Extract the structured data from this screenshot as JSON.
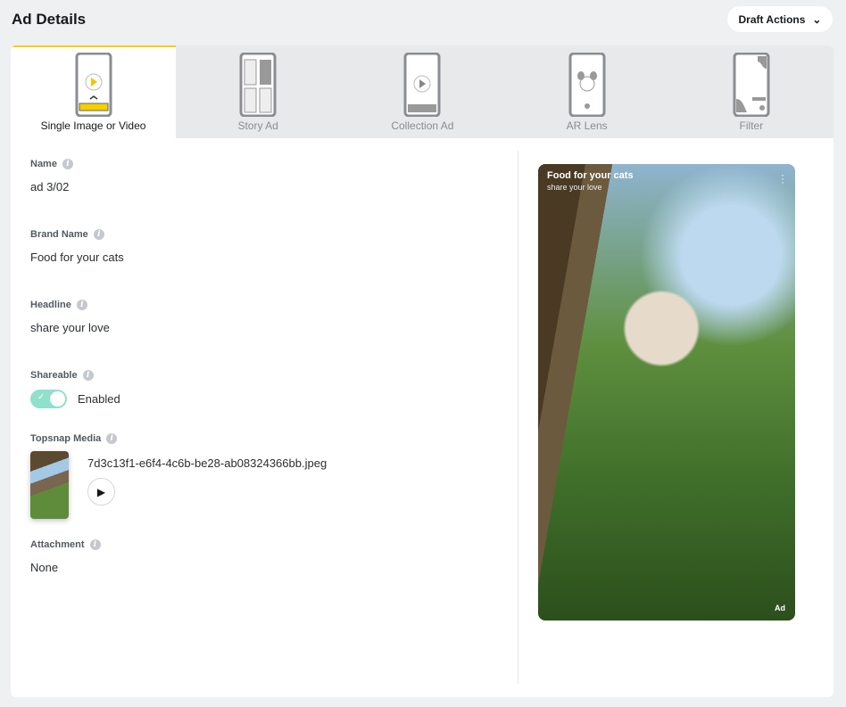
{
  "header": {
    "title": "Ad Details",
    "draft_actions": "Draft Actions"
  },
  "tabs": [
    {
      "label": "Single Image or Video",
      "active": true
    },
    {
      "label": "Story Ad"
    },
    {
      "label": "Collection Ad"
    },
    {
      "label": "AR Lens"
    },
    {
      "label": "Filter"
    }
  ],
  "fields": {
    "name": {
      "label": "Name",
      "value": "ad 3/02"
    },
    "brand": {
      "label": "Brand Name",
      "value": "Food for your cats"
    },
    "headline": {
      "label": "Headline",
      "value": "share your love"
    },
    "shareable": {
      "label": "Shareable",
      "value": "Enabled",
      "enabled": true
    },
    "media": {
      "label": "Topsnap Media",
      "filename": "7d3c13f1-e6f4-4c6b-be28-ab08324366bb.jpeg"
    },
    "attachment": {
      "label": "Attachment",
      "value": "None"
    }
  },
  "preview": {
    "brand": "Food for your cats",
    "headline": "share your love",
    "ad_badge": "Ad"
  },
  "colors": {
    "accent": "#f5d000",
    "toggle": "#8fe0cc"
  }
}
